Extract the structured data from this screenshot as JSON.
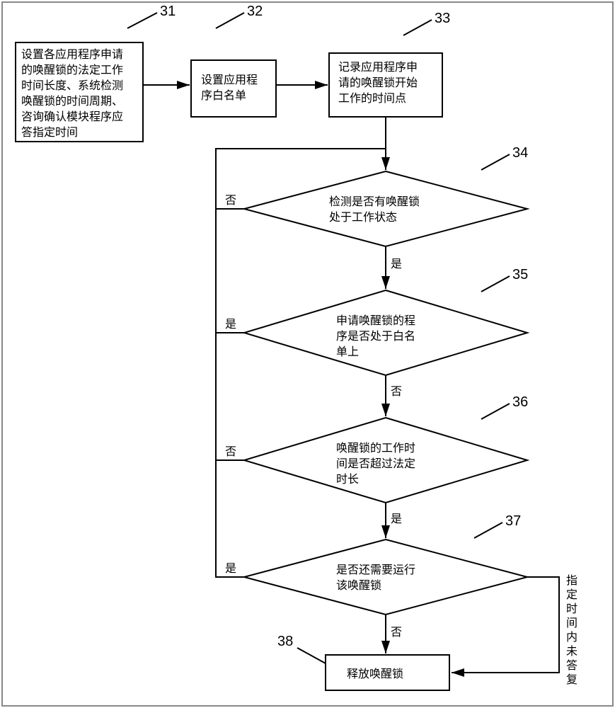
{
  "labels": {
    "n31": "31",
    "n32": "32",
    "n33": "33",
    "n34": "34",
    "n35": "35",
    "n36": "36",
    "n37": "37",
    "n38": "38"
  },
  "boxes": {
    "b31_l1": "设置各应用程序申请",
    "b31_l2": "的唤醒锁的法定工作",
    "b31_l3": "时间长度、系统检测",
    "b31_l4": "唤醒锁的时间周期、",
    "b31_l5": "咨询确认模块程序应",
    "b31_l6": "答指定时间",
    "b32_l1": "设置应用程",
    "b32_l2": "序白名单",
    "b33_l1": "记录应用程序申",
    "b33_l2": "请的唤醒锁开始",
    "b33_l3": "工作的时间点",
    "b34_l1": "检测是否有唤醒锁",
    "b34_l2": "处于工作状态",
    "b35_l1": "申请唤醒锁的程",
    "b35_l2": "序是否处于白名",
    "b35_l3": "单上",
    "b36_l1": "唤醒锁的工作时",
    "b36_l2": "间是否超过法定",
    "b36_l3": "时长",
    "b37_l1": "是否还需要运行",
    "b37_l2": "该唤醒锁",
    "b38": "释放唤醒锁"
  },
  "edges": {
    "yes": "是",
    "no": "否",
    "timeout_l1": "指",
    "timeout_l2": "定",
    "timeout_l3": "时",
    "timeout_l4": "间",
    "timeout_l5": "内",
    "timeout_l6": "未",
    "timeout_l7": "答",
    "timeout_l8": "复"
  }
}
